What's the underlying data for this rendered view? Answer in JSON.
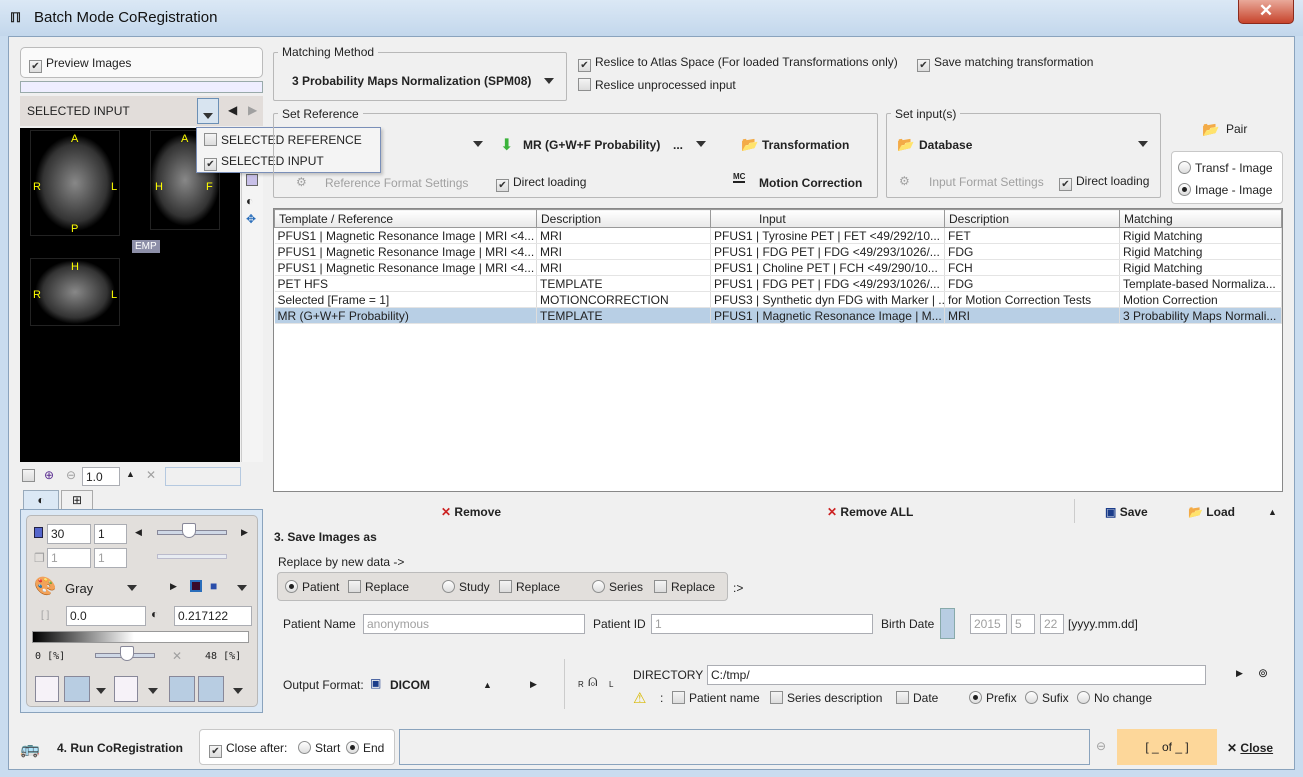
{
  "window": {
    "title": "Batch Mode CoRegistration",
    "close": "✕"
  },
  "preview": {
    "label": "Preview Images",
    "checked": true,
    "selector": "SELECTED INPUT",
    "menu": [
      {
        "label": "SELECTED REFERENCE",
        "checked": false
      },
      {
        "label": "SELECTED INPUT",
        "checked": true
      }
    ],
    "orient": {
      "a": "A",
      "p": "P",
      "r": "R",
      "l": "L",
      "h": "H",
      "f": "F"
    },
    "emp": "EMP",
    "zoom": "1.0"
  },
  "matching": {
    "title": "Matching Method",
    "value": "3 Probability Maps Normalization (SPM08)",
    "reslice_atlas": "Reslice to Atlas Space (For loaded Transformations only)",
    "save_transform": "Save matching transformation",
    "reslice_unprocessed": "Reslice unprocessed input"
  },
  "reference": {
    "title": "Set Reference",
    "template": "MR (G+W+F Probability)",
    "more": "...",
    "transformation": "Transformation",
    "format_settings": "Reference Format Settings",
    "direct_loading": "Direct loading",
    "motion_correction": "Motion Correction",
    "mc_icon": "MC"
  },
  "input": {
    "title": "Set input(s)",
    "source": "Database",
    "format_settings": "Input Format Settings",
    "direct_loading": "Direct loading"
  },
  "pair": {
    "label": "Pair",
    "options": [
      "Transf - Image",
      "Image - Image"
    ],
    "selected": 1
  },
  "table": {
    "columns": [
      "Template / Reference",
      "Description",
      "Input",
      "Description",
      "Matching"
    ],
    "rows": [
      [
        "PFUS1 | Magnetic Resonance Image | MRI <4...",
        "MRI",
        "PFUS1 | Tyrosine PET | FET <49/292/10...",
        "FET",
        "Rigid Matching"
      ],
      [
        "PFUS1 | Magnetic Resonance Image | MRI <4...",
        "MRI",
        "PFUS1 | FDG PET | FDG <49/293/1026/...",
        "FDG",
        "Rigid Matching"
      ],
      [
        "PFUS1 | Magnetic Resonance Image | MRI <4...",
        "MRI",
        "PFUS1 | Choline PET | FCH <49/290/10...",
        "FCH",
        "Rigid Matching"
      ],
      [
        "PET HFS",
        "TEMPLATE",
        "PFUS1 | FDG PET | FDG <49/293/1026/...",
        "FDG",
        "Template-based Normaliza..."
      ],
      [
        "Selected [Frame = 1]",
        "MOTIONCORRECTION",
        "PFUS3 | Synthetic dyn FDG with Marker | ...",
        "for Motion Correction Tests",
        "Motion Correction"
      ],
      [
        "MR (G+W+F Probability)",
        "TEMPLATE",
        "PFUS1 | Magnetic Resonance Image | M...",
        "MRI",
        "3 Probability Maps Normali..."
      ]
    ],
    "selected_row": 5
  },
  "actions": {
    "remove": "Remove",
    "remove_all": "Remove ALL",
    "save": "Save",
    "load": "Load"
  },
  "save_images": {
    "title": "3. Save Images as",
    "replace_title": "Replace by new data ->",
    "patient": "Patient",
    "study": "Study",
    "series": "Series",
    "replace": "Replace",
    "arrow": ":>",
    "patient_name_label": "Patient Name",
    "patient_name": "anonymous",
    "patient_id_label": "Patient ID",
    "patient_id": "1",
    "birth_label": "Birth Date",
    "year": "2015",
    "month": "5",
    "day": "22",
    "date_format": "[yyyy.mm.dd]",
    "output_label": "Output Format:",
    "output": "DICOM",
    "directory_label": "DIRECTORY",
    "directory": "C:/tmp/",
    "opt_patient": "Patient name",
    "opt_series": "Series description",
    "opt_date": "Date",
    "prefix": "Prefix",
    "sufix": "Sufix",
    "nochange": "No change",
    "rl_r": "R",
    "rl_l": "L"
  },
  "controls": {
    "slice": "30",
    "step": "1",
    "frame": "1",
    "frame_step": "1",
    "lut": "Gray",
    "min": "0.0",
    "max": "0.217122",
    "pct_min": "0",
    "pct_max": "48",
    "pct_unit": "[%]"
  },
  "run": {
    "label": "4. Run CoRegistration",
    "close_after": "Close after:",
    "start": "Start",
    "end": "End",
    "counter": "[ _ of _ ]",
    "close": "Close"
  }
}
